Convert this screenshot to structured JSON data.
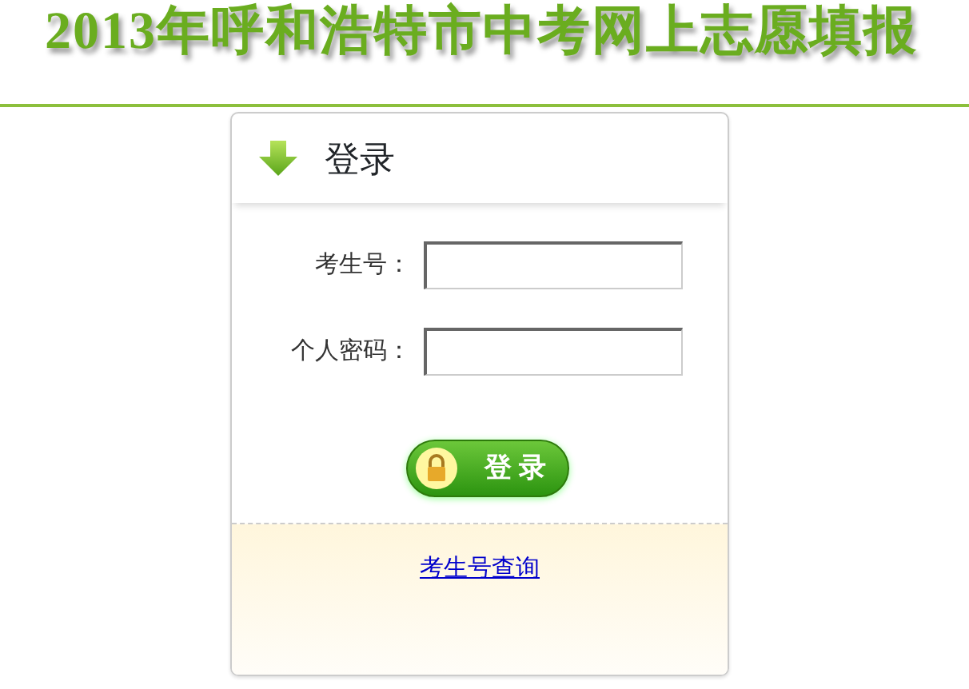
{
  "page_title": "2013年呼和浩特市中考网上志愿填报",
  "login_panel": {
    "heading": "登录",
    "fields": [
      {
        "label": "考生号："
      },
      {
        "label": "个人密码："
      }
    ],
    "button": "登 录",
    "link": "考生号查询"
  }
}
